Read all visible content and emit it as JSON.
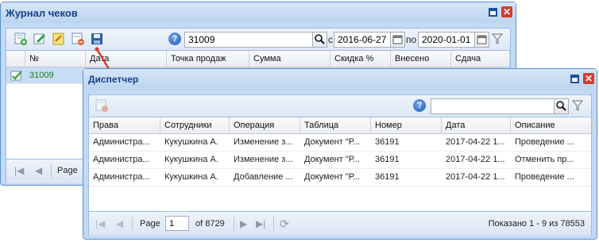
{
  "back_window": {
    "title": "Журнал чеков",
    "search_value": "31009",
    "date_from_label": "с",
    "date_from": "2016-06-27",
    "date_to_label": "по",
    "date_to": "2020-01-01",
    "columns": [
      "№",
      "Дата",
      "Точка продаж",
      "Сумма",
      "Скидка %",
      "Внесено",
      "Сдача"
    ],
    "rows": [
      {
        "number": "31009"
      }
    ],
    "pager": {
      "page_label": "Page"
    }
  },
  "front_window": {
    "title": "Диспетчер",
    "search_value": "",
    "columns": [
      "Права",
      "Сотрудники",
      "Операция",
      "Таблица",
      "Номер",
      "Дата",
      "Описание"
    ],
    "rows": [
      [
        "Администра...",
        "Кукушкина А.",
        "Изменение з...",
        "Документ \"Р...",
        "36191",
        "2017-04-22 1...",
        "Проведение ..."
      ],
      [
        "Администра...",
        "Кукушкина А.",
        "Изменение з...",
        "Документ \"Р...",
        "36191",
        "2017-04-22 1...",
        "Отменить пр..."
      ],
      [
        "Администра...",
        "Кукушкина А.",
        "Добавление ...",
        "Документ \"Р...",
        "36191",
        "2017-04-22 1...",
        "Проведение ..."
      ]
    ],
    "pager": {
      "page_label": "Page",
      "page_value": "1",
      "of_label": "of 8729",
      "display_info": "Показано 1 - 9 из 78553"
    }
  },
  "icons": {
    "help": "?",
    "close": "✕",
    "search": "search-icon",
    "filter": "filter-icon"
  },
  "colors": {
    "window_border": "#5a8fd0",
    "title_text": "#15428b",
    "selected_row": "#c7ddf5",
    "arrow": "#e0342a"
  }
}
